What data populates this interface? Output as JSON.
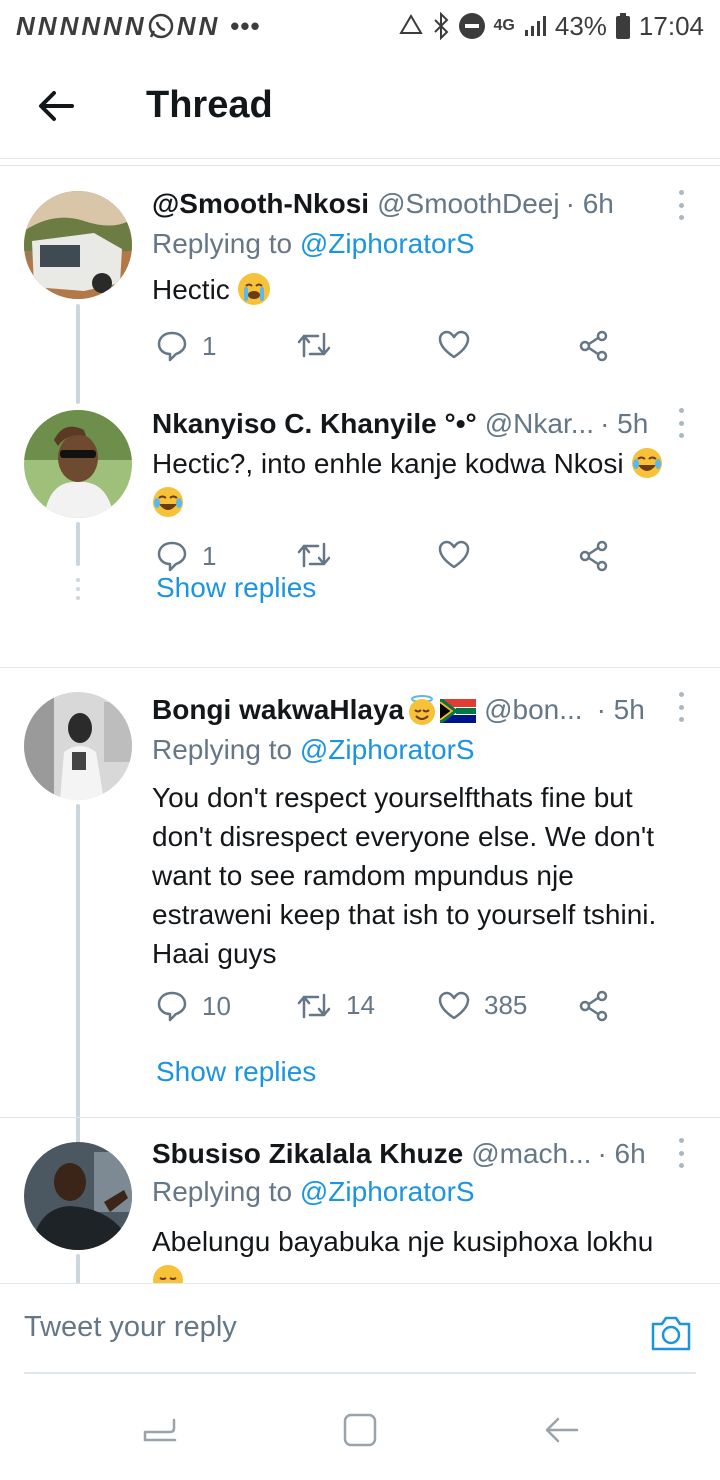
{
  "status_bar": {
    "notif_letters": [
      "N",
      "N",
      "N",
      "N",
      "N",
      "N",
      "N",
      "N"
    ],
    "network": "4G",
    "battery": "43%",
    "time": "17:04"
  },
  "header": {
    "title": "Thread"
  },
  "tweets": [
    {
      "name": "@Smooth-Nkosi",
      "handle": "@SmoothDeej",
      "time": "· 6h",
      "replying_prefix": "Replying to ",
      "replying_to": "@ZiphoratorS",
      "text": "Hectic",
      "replies": "1",
      "retweets": "",
      "likes": ""
    },
    {
      "name": "Nkanyiso C. Khanyile °•°",
      "handle": "@Nkar...",
      "time": "· 5h",
      "text": "Hectic?, into enhle kanje kodwa Nkosi",
      "replies": "1",
      "retweets": "",
      "likes": "",
      "show_replies": "Show replies"
    },
    {
      "name": "Bongi wakwaHlaya",
      "handle": "@bon...",
      "time": "· 5h",
      "replying_prefix": "Replying to ",
      "replying_to": "@ZiphoratorS",
      "text": "You don't respect yourselfthats fine but don't disrespect everyone else. We don't want to see ramdom mpundus nje estraweni keep that ish to yourself tshini. Haai guys",
      "replies": "10",
      "retweets": "14",
      "likes": "385",
      "show_replies": "Show replies"
    },
    {
      "name": "Sbusiso Zikalala Khuze",
      "handle": "@mach...",
      "time": "· 6h",
      "replying_prefix": "Replying to ",
      "replying_to": "@ZiphoratorS",
      "text": "Abelungu bayabuka nje kusiphoxa lokhu"
    }
  ],
  "reply_bar": {
    "placeholder": "Tweet your reply"
  },
  "colors": {
    "accent": "#1b95e0",
    "secondary_text": "#657786",
    "divider": "#e1e8ed"
  },
  "icons": {
    "back": "arrow-left-icon",
    "reply": "speech-bubble-icon",
    "retweet": "retweet-icon",
    "like": "heart-icon",
    "share": "share-icon",
    "more": "more-vertical-icon",
    "camera": "camera-icon"
  }
}
